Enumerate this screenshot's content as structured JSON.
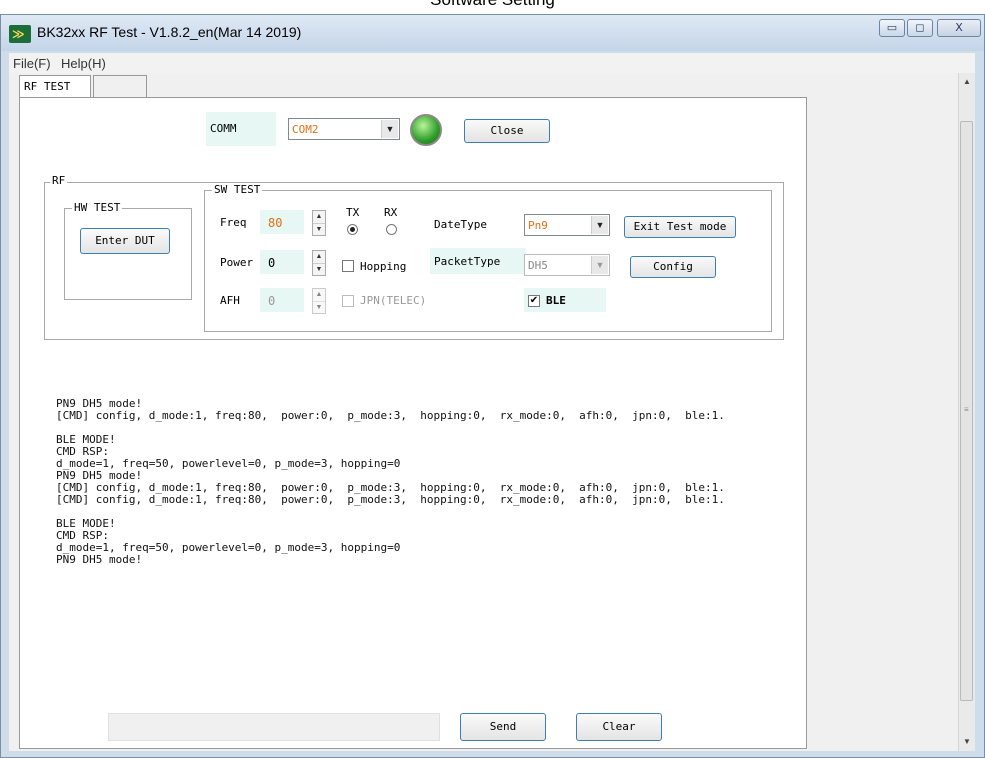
{
  "caption": "Software Setting",
  "window": {
    "title": "BK32xx RF Test - V1.8.2_en(Mar 14 2019)",
    "minimize_glyph": "▭",
    "maximize_glyph": "◻",
    "close_glyph": "X"
  },
  "menu": [
    "File(F)",
    "Help(H)"
  ],
  "tabs": [
    "RF TEST",
    ""
  ],
  "comm": {
    "label": "COMM",
    "port": "COM2",
    "close_label": "Close",
    "led_color": "#2e9d2a"
  },
  "rf_group": {
    "title": "RF",
    "hw_test": {
      "title": "HW TEST",
      "enter_dut_label": "Enter DUT"
    },
    "sw_test": {
      "title": "SW TEST",
      "freq_label": "Freq",
      "freq_value": "80",
      "power_label": "Power",
      "power_value": "0",
      "afh_label": "AFH",
      "afh_value": "0",
      "tx_label": "TX",
      "rx_label": "RX",
      "hopping_label": "Hopping",
      "jpn_label": "JPN(TELEC)",
      "datetype_label": "DateType",
      "datetype_value": "Pn9",
      "packettype_label": "PacketType",
      "packettype_value": "DH5",
      "ble_label": "BLE",
      "exit_label": "Exit Test mode",
      "config_label": "Config"
    }
  },
  "log": [
    "PN9 DH5 mode!",
    "[CMD] config, d_mode:1, freq:80,  power:0,  p_mode:3,  hopping:0,  rx_mode:0,  afh:0,  jpn:0,  ble:1.",
    "",
    "BLE MODE!",
    "CMD RSP:",
    "d_mode=1, freq=50, powerlevel=0, p_mode=3, hopping=0",
    "PN9 DH5 mode!",
    "[CMD] config, d_mode:1, freq:80,  power:0,  p_mode:3,  hopping:0,  rx_mode:0,  afh:0,  jpn:0,  ble:1.",
    "[CMD] config, d_mode:1, freq:80,  power:0,  p_mode:3,  hopping:0,  rx_mode:0,  afh:0,  jpn:0,  ble:1.",
    "",
    "BLE MODE!",
    "CMD RSP:",
    "d_mode=1, freq=50, powerlevel=0, p_mode=3, hopping=0",
    "PN9 DH5 mode!"
  ],
  "bottom": {
    "send_label": "Send",
    "clear_label": "Clear"
  },
  "colors": {
    "highlight_text": "#e07010",
    "field_bg": "#e6f7f4"
  }
}
